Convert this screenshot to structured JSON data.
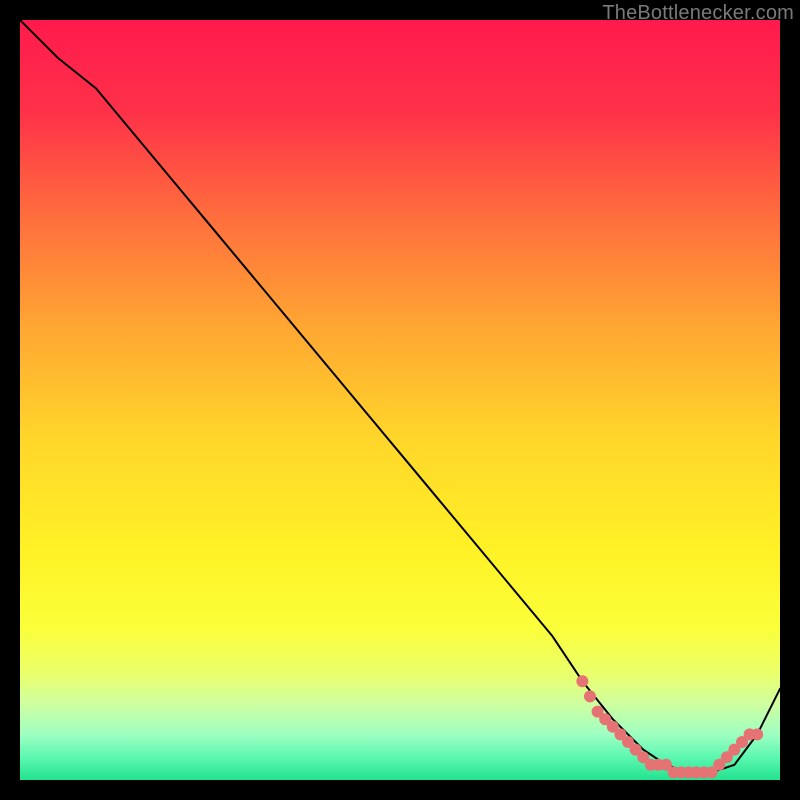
{
  "watermark": "TheBottlenecker.com",
  "chart_data": {
    "type": "line",
    "title": "",
    "xlabel": "",
    "ylabel": "",
    "xlim": [
      0,
      100
    ],
    "ylim": [
      0,
      100
    ],
    "grid": false,
    "legend": false,
    "background_gradient": {
      "stops": [
        {
          "offset": 0.0,
          "color": "#ff1a4d"
        },
        {
          "offset": 0.12,
          "color": "#ff3149"
        },
        {
          "offset": 0.25,
          "color": "#ff6a3e"
        },
        {
          "offset": 0.4,
          "color": "#ffa533"
        },
        {
          "offset": 0.55,
          "color": "#ffd62a"
        },
        {
          "offset": 0.7,
          "color": "#fff226"
        },
        {
          "offset": 0.8,
          "color": "#fbff3a"
        },
        {
          "offset": 0.86,
          "color": "#eaff6b"
        },
        {
          "offset": 0.9,
          "color": "#cfffa0"
        },
        {
          "offset": 0.94,
          "color": "#9effc2"
        },
        {
          "offset": 0.97,
          "color": "#5cf7b0"
        },
        {
          "offset": 1.0,
          "color": "#22e38f"
        }
      ]
    },
    "series": [
      {
        "name": "bottleneck-curve",
        "stroke": "#000000",
        "stroke_width": 2,
        "marker": null,
        "x": [
          0,
          5,
          10,
          15,
          20,
          25,
          30,
          35,
          40,
          45,
          50,
          55,
          60,
          65,
          70,
          74,
          78,
          82,
          85,
          88,
          91,
          94,
          97,
          100
        ],
        "y": [
          100,
          95,
          91,
          85,
          79,
          73,
          67,
          61,
          55,
          49,
          43,
          37,
          31,
          25,
          19,
          13,
          8,
          4,
          2,
          1,
          1,
          2,
          6,
          12
        ]
      },
      {
        "name": "markers",
        "stroke": null,
        "marker": {
          "shape": "circle",
          "radius": 6,
          "fill": "#e57373"
        },
        "x": [
          74,
          75,
          76,
          77,
          78,
          79,
          80,
          81,
          82,
          83,
          84,
          85,
          86,
          87,
          88,
          89,
          90,
          91,
          92,
          93,
          94,
          95,
          96,
          97
        ],
        "y": [
          13,
          11,
          9,
          8,
          7,
          6,
          5,
          4,
          3,
          2,
          2,
          2,
          1,
          1,
          1,
          1,
          1,
          1,
          2,
          3,
          4,
          5,
          6,
          6
        ]
      }
    ]
  }
}
